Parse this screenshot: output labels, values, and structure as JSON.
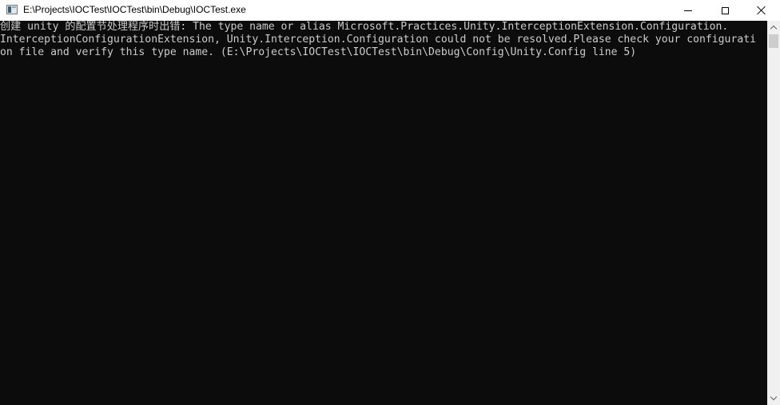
{
  "window": {
    "title": "E:\\Projects\\IOCTest\\IOCTest\\bin\\Debug\\IOCTest.exe",
    "icon": "console-app-icon",
    "controls": {
      "minimize": "minimize-icon",
      "maximize": "maximize-icon",
      "close": "close-icon"
    }
  },
  "console": {
    "lines": [
      "创建 unity 的配置节处理程序时出错: The type name or alias Microsoft.Practices.Unity.InterceptionExtension.Configuration.",
      "InterceptionConfigurationExtension, Unity.Interception.Configuration could not be resolved.Please check your configurati",
      "on file and verify this type name. (E:\\Projects\\IOCTest\\IOCTest\\bin\\Debug\\Config\\Unity.Config line 5)"
    ],
    "colors": {
      "background": "#0c0c0c",
      "foreground": "#cccccc"
    }
  },
  "scrollbar": {
    "up_icon": "chevron-up-icon",
    "down_icon": "chevron-down-icon",
    "position": 0
  }
}
